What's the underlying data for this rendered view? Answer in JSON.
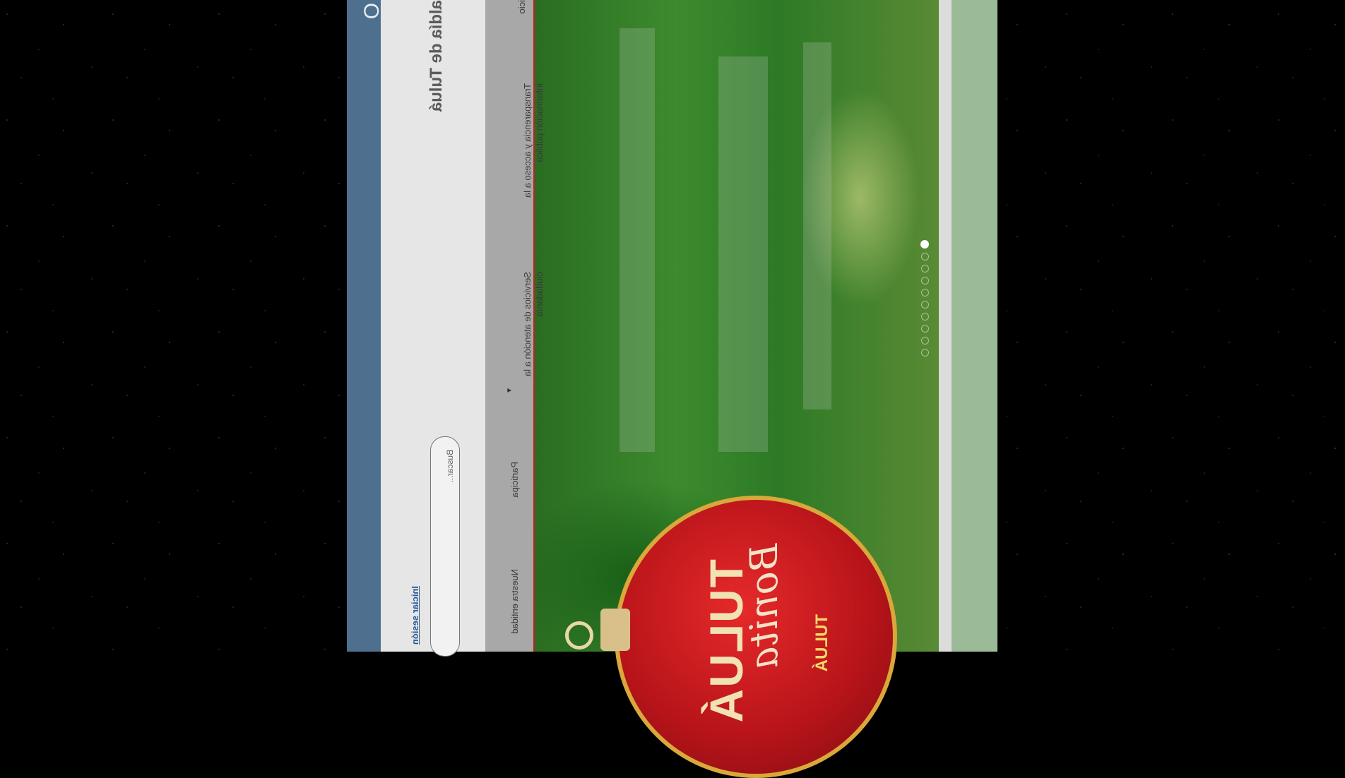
{
  "header": {
    "brand_partial": "O",
    "site_title": "aldía de Tuluá",
    "login_link": "Iniciar sesión",
    "search_placeholder": "Buscar..."
  },
  "nav": {
    "items": [
      {
        "label": "icio"
      },
      {
        "label": "Transparencia y acceso a la información pública"
      },
      {
        "label": "Servicios de atención a la ciudadanía"
      },
      {
        "label": "Participa"
      },
      {
        "label": "Nuestra entidad"
      }
    ],
    "dropdown_caret": "▼"
  },
  "hero": {
    "banner_word_1": "TULUÁ",
    "banner_word_2": "Bonita",
    "banner_word_3": "TULUÁ",
    "carousel_slides": 10,
    "carousel_active_index": 0
  }
}
